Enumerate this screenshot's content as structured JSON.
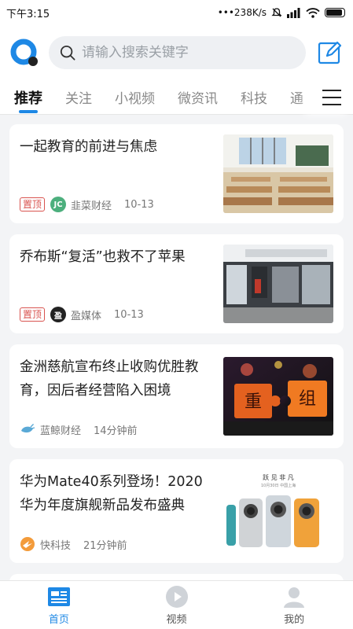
{
  "status_bar": {
    "time": "下午3:15",
    "speed": "•••238K/s",
    "battery_level": 0.9
  },
  "search": {
    "placeholder": "请输入搜索关键字"
  },
  "tabs": [
    {
      "label": "推荐",
      "active": true
    },
    {
      "label": "关注"
    },
    {
      "label": "小视频"
    },
    {
      "label": "微资讯"
    },
    {
      "label": "科技"
    },
    {
      "label": "通"
    }
  ],
  "articles": [
    {
      "title": "一起教育的前进与焦虑",
      "pinned": true,
      "pin_label": "置顶",
      "source": "韭菜财经",
      "source_icon": "jiucai-logo",
      "time": "10-13",
      "image": "classroom-photo"
    },
    {
      "title": "乔布斯“复活”也救不了苹果",
      "pinned": true,
      "pin_label": "置顶",
      "source": "盈媒体",
      "source_icon": "yingmeiti-logo",
      "time": "10-13",
      "image": "apple-store-photo"
    },
    {
      "title": "金洲慈航宣布终止收购优胜教育，因后者经营陷入困境",
      "pinned": false,
      "source": "蓝鲸财经",
      "source_icon": "lanjing-logo",
      "time": "14分钟前",
      "image": "puzzle-zhongzu",
      "image_text": [
        "重",
        "组"
      ]
    },
    {
      "title": "华为Mate40系列登场！2020华为年度旗舰新品发布盛典",
      "pinned": false,
      "source": "快科技",
      "source_icon": "kuaikeji-logo",
      "time": "21分钟前",
      "image": "huawei-mate40-phones",
      "image_text": [
        "跃 见 非 凡",
        "10月30日 中国上海"
      ]
    }
  ],
  "bottom_nav": [
    {
      "label": "首页",
      "icon": "home-news-icon",
      "active": true
    },
    {
      "label": "视频",
      "icon": "video-play-icon"
    },
    {
      "label": "我的",
      "icon": "profile-icon"
    }
  ],
  "colors": {
    "accent": "#1e88e5",
    "pin_red": "#d9534f"
  }
}
